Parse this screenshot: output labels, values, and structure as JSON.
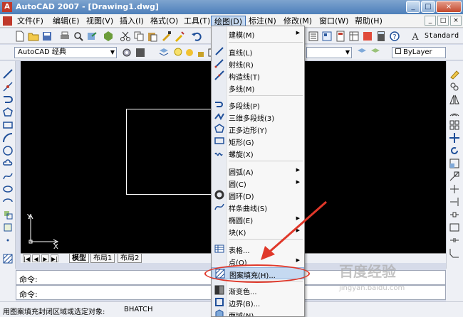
{
  "window": {
    "title": "AutoCAD 2007 - [Drawing1.dwg]",
    "app_icon": "A",
    "minimize": "_",
    "maximize": "□",
    "close": "×"
  },
  "menubar": {
    "items": [
      "文件(F)",
      "编辑(E)",
      "视图(V)",
      "插入(I)",
      "格式(O)",
      "工具(T)",
      "绘图(D)",
      "标注(N)",
      "修改(M)",
      "窗口(W)",
      "帮助(H)"
    ],
    "active_index": 6,
    "mdi": [
      "_",
      "□",
      "×"
    ]
  },
  "toolbar": {
    "workspace": "AutoCAD 经典",
    "text_style": "Standard",
    "bylayer": "ByLayer"
  },
  "draw_menu": {
    "items": [
      {
        "label": "建模(M)",
        "submenu": true
      },
      {
        "sep": true
      },
      {
        "label": "直线(L)",
        "icon": "line-icon"
      },
      {
        "label": "射线(R)",
        "icon": "ray-icon"
      },
      {
        "label": "构造线(T)",
        "icon": "construction-line-icon"
      },
      {
        "label": "多线(M)"
      },
      {
        "sep": true
      },
      {
        "label": "多段线(P)",
        "icon": "polyline-icon"
      },
      {
        "label": "三维多段线(3)",
        "icon": "3d-polyline-icon"
      },
      {
        "label": "正多边形(Y)",
        "icon": "polygon-icon"
      },
      {
        "label": "矩形(G)",
        "icon": "rectangle-icon"
      },
      {
        "label": "螺旋(X)",
        "icon": "helix-icon"
      },
      {
        "sep": true
      },
      {
        "label": "圆弧(A)",
        "submenu": true
      },
      {
        "label": "圆(C)",
        "submenu": true
      },
      {
        "label": "圆环(D)",
        "icon": "donut-icon"
      },
      {
        "label": "样条曲线(S)",
        "icon": "spline-icon"
      },
      {
        "label": "椭圆(E)",
        "submenu": true
      },
      {
        "label": "块(K)",
        "submenu": true
      },
      {
        "sep": true
      },
      {
        "label": "表格...",
        "icon": "table-icon"
      },
      {
        "label": "点(O)",
        "submenu": true
      },
      {
        "label": "图案填充(H)...",
        "icon": "hatch-icon",
        "highlighted": true
      },
      {
        "label": "渐变色...",
        "icon": "gradient-icon"
      },
      {
        "label": "边界(B)...",
        "icon": "boundary-icon"
      },
      {
        "label": "面域(N)",
        "icon": "region-icon"
      }
    ]
  },
  "layout_tabs": [
    "模型",
    "布局1",
    "布局2"
  ],
  "ucs": {
    "x": "X",
    "y": "Y"
  },
  "command": {
    "line1": "命令:",
    "line2": "命令:"
  },
  "status": {
    "prompt": "用图案填充封闭区域或选定对象:",
    "command": "BHATCH"
  },
  "watermark": {
    "main": "百度经验",
    "url": "jingyan.baidu.com"
  },
  "colors": {
    "accent_highlight": "#c5d9f1",
    "annotation": "#e0382a",
    "canvas": "#000000"
  }
}
